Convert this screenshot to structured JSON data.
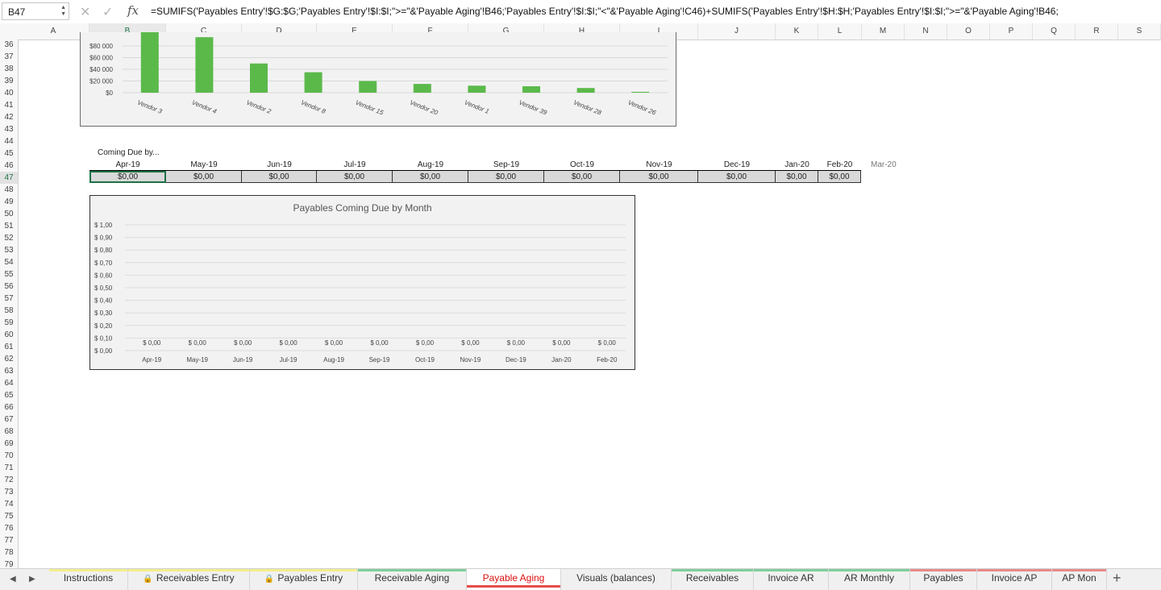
{
  "formula_bar": {
    "cell_ref": "B47",
    "formula": "=SUMIFS('Payables Entry'!$G:$G;'Payables Entry'!$I:$I;\">=\"&'Payable Aging'!B46;'Payables Entry'!$I:$I;\"<\"&'Payable Aging'!C46)+SUMIFS('Payables Entry'!$H:$H;'Payables Entry'!$I:$I;\">=\"&'Payable Aging'!B46;",
    "cancel_icon": "x-icon",
    "confirm_icon": "check-icon",
    "fx_label": "fx"
  },
  "columns": [
    "A",
    "B",
    "C",
    "D",
    "E",
    "F",
    "G",
    "H",
    "I",
    "J",
    "K",
    "L",
    "M",
    "N",
    "O",
    "P",
    "Q",
    "R",
    "S"
  ],
  "active_column": "B",
  "rows": [
    "36",
    "37",
    "38",
    "39",
    "40",
    "41",
    "42",
    "43",
    "44",
    "45",
    "46",
    "47",
    "48",
    "49",
    "50",
    "51",
    "52",
    "53",
    "54",
    "55",
    "56",
    "57",
    "58",
    "59",
    "60",
    "61",
    "62",
    "63",
    "64",
    "65",
    "66",
    "67",
    "68",
    "69",
    "70",
    "71",
    "72",
    "73",
    "74",
    "75",
    "76",
    "77",
    "78",
    "79"
  ],
  "active_row": "47",
  "top_chart": {
    "chart_data": {
      "type": "bar",
      "categories": [
        "Vendor 3",
        "Vendor 4",
        "Vendor 2",
        "Vendor 8",
        "Vendor 15",
        "Vendor 20",
        "Vendor 1",
        "Vendor 39",
        "Vendor 28",
        "Vendor 26"
      ],
      "values": [
        105000,
        95000,
        50000,
        35000,
        20000,
        15000,
        12000,
        11000,
        8000,
        1500
      ],
      "yticks": [
        "$0",
        "$20 000",
        "$40 000",
        "$60 000",
        "$80 000"
      ],
      "ytick_values": [
        0,
        20000,
        40000,
        60000,
        80000
      ],
      "ylim": [
        0,
        80000
      ],
      "bar_color": "#5bb94a"
    }
  },
  "coming_due": {
    "label": "Coming Due by...",
    "months": [
      "Apr-19",
      "May-19",
      "Jun-19",
      "Jul-19",
      "Aug-19",
      "Sep-19",
      "Oct-19",
      "Nov-19",
      "Dec-19",
      "Jan-20",
      "Feb-20"
    ],
    "values": [
      "$0,00",
      "$0,00",
      "$0,00",
      "$0,00",
      "$0,00",
      "$0,00",
      "$0,00",
      "$0,00",
      "$0,00",
      "$0,00",
      "$0,00"
    ],
    "extra_month": "Mar-20"
  },
  "bottom_chart": {
    "chart_data": {
      "type": "bar",
      "title": "Payables Coming Due by Month",
      "categories": [
        "Apr-19",
        "May-19",
        "Jun-19",
        "Jul-19",
        "Aug-19",
        "Sep-19",
        "Oct-19",
        "Nov-19",
        "Dec-19",
        "Jan-20",
        "Feb-20"
      ],
      "values": [
        0,
        0,
        0,
        0,
        0,
        0,
        0,
        0,
        0,
        0,
        0
      ],
      "data_labels": [
        "$ 0,00",
        "$ 0,00",
        "$ 0,00",
        "$ 0,00",
        "$ 0,00",
        "$ 0,00",
        "$ 0,00",
        "$ 0,00",
        "$ 0,00",
        "$ 0,00",
        "$ 0,00"
      ],
      "yticks": [
        "$ 0,00",
        "$ 0,10",
        "$ 0,20",
        "$ 0,30",
        "$ 0,40",
        "$ 0,50",
        "$ 0,60",
        "$ 0,70",
        "$ 0,80",
        "$ 0,90",
        "$ 1,00"
      ],
      "ytick_values": [
        0,
        0.1,
        0.2,
        0.3,
        0.4,
        0.5,
        0.6,
        0.7,
        0.8,
        0.9,
        1.0
      ],
      "ylim": [
        0,
        1.0
      ],
      "grid": true
    }
  },
  "sheet_tabs": [
    {
      "label": "Instructions",
      "color": "#f3ef8a",
      "locked": false
    },
    {
      "label": "Receivables Entry",
      "color": "#f3ef8a",
      "locked": true
    },
    {
      "label": "Payables Entry",
      "color": "#f3ef8a",
      "locked": true
    },
    {
      "label": "Receivable Aging",
      "color": "#7fcf9b",
      "locked": false
    },
    {
      "label": "Payable Aging",
      "color": "#e74c4c",
      "locked": false,
      "active": true
    },
    {
      "label": "Visuals (balances)",
      "color": "",
      "locked": false
    },
    {
      "label": "Receivables",
      "color": "#7fcf9b",
      "locked": false
    },
    {
      "label": "Invoice AR",
      "color": "#7fcf9b",
      "locked": false
    },
    {
      "label": "AR Monthly",
      "color": "#7fcf9b",
      "locked": false
    },
    {
      "label": "Payables",
      "color": "#e88a8a",
      "locked": false
    },
    {
      "label": "Invoice AP",
      "color": "#e88a8a",
      "locked": false
    },
    {
      "label": "AP Mon",
      "color": "#e88a8a",
      "locked": false
    }
  ],
  "add_tab_label": "+"
}
